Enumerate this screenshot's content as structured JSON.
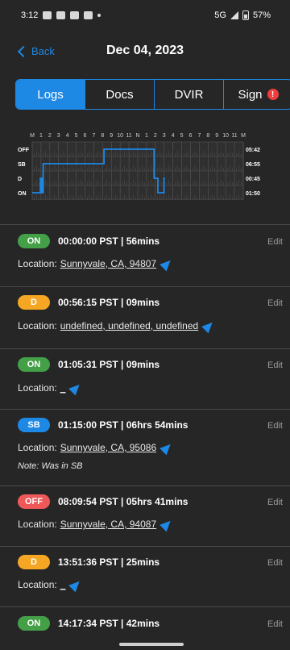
{
  "status_bar": {
    "time": "3:12",
    "network": "5G",
    "battery": "57%"
  },
  "header": {
    "back_label": "Back",
    "title": "Dec 04, 2023"
  },
  "tabs": [
    {
      "label": "Logs",
      "active": true
    },
    {
      "label": "Docs",
      "active": false
    },
    {
      "label": "DVIR",
      "active": false
    },
    {
      "label": "Sign",
      "active": false,
      "alert": "!"
    }
  ],
  "chart_data": {
    "type": "line",
    "hour_labels": [
      "M",
      "1",
      "2",
      "3",
      "4",
      "5",
      "6",
      "7",
      "8",
      "9",
      "10",
      "11",
      "N",
      "1",
      "2",
      "3",
      "4",
      "5",
      "6",
      "7",
      "8",
      "9",
      "10",
      "11",
      "M"
    ],
    "row_labels": [
      "OFF",
      "SB",
      "D",
      "ON"
    ],
    "row_totals": [
      "05:42",
      "06:55",
      "00:45",
      "01:50"
    ],
    "line_color": "#1e88e5",
    "segments": [
      {
        "status": "ON",
        "start": 0.0,
        "end": 0.9333
      },
      {
        "status": "D",
        "start": 0.9333,
        "end": 1.0875
      },
      {
        "status": "ON",
        "start": 1.0875,
        "end": 1.25
      },
      {
        "status": "SB",
        "start": 1.25,
        "end": 8.165
      },
      {
        "status": "OFF",
        "start": 8.165,
        "end": 13.86
      },
      {
        "status": "D",
        "start": 13.86,
        "end": 14.2917
      },
      {
        "status": "ON",
        "start": 14.2917,
        "end": 14.9833
      },
      {
        "status": "D",
        "start": 14.9833,
        "end": 15.1
      }
    ]
  },
  "entries": [
    {
      "status": "ON",
      "time": "00:00:00 PST | 56mins",
      "location_label": "Location:",
      "location": "Sunnyvale, CA, 94807",
      "note": ""
    },
    {
      "status": "D",
      "time": "00:56:15 PST | 09mins",
      "location_label": "Location:",
      "location": "undefined, undefined, undefined",
      "note": ""
    },
    {
      "status": "ON",
      "time": "01:05:31 PST | 09mins",
      "location_label": "Location:",
      "location": "_",
      "note": ""
    },
    {
      "status": "SB",
      "time": "01:15:00 PST | 06hrs 54mins",
      "location_label": "Location:",
      "location": "Sunnyvale, CA, 95086",
      "note": "Note: Was in SB"
    },
    {
      "status": "OFF",
      "time": "08:09:54 PST | 05hrs 41mins",
      "location_label": "Location:",
      "location": "Sunnyvale, CA, 94087",
      "note": ""
    },
    {
      "status": "D",
      "time": "13:51:36 PST | 25mins",
      "location_label": "Location:",
      "location": "_",
      "note": ""
    },
    {
      "status": "ON",
      "time": "14:17:34 PST | 42mins",
      "location_label": "",
      "location": "",
      "note": ""
    }
  ],
  "edit_label": "Edit"
}
